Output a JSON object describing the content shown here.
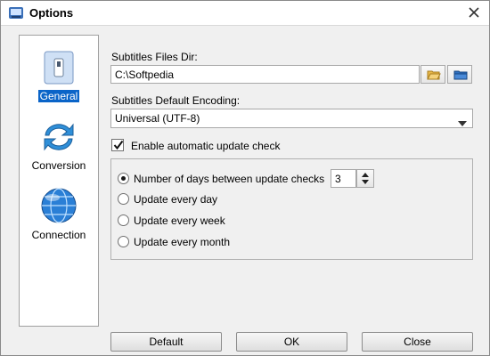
{
  "window": {
    "title": "Options",
    "icon": "options-window-icon",
    "close_icon": "close-icon"
  },
  "nav": {
    "items": [
      {
        "label": "General",
        "icon": "switch-icon",
        "active": true
      },
      {
        "label": "Conversion",
        "icon": "refresh-arrows-icon",
        "active": false
      },
      {
        "label": "Connection",
        "icon": "globe-icon",
        "active": false
      }
    ]
  },
  "general": {
    "subtitles_dir_label": "Subtitles Files Dir:",
    "subtitles_dir_value": "C:\\Softpedia",
    "encoding_label": "Subtitles Default Encoding:",
    "encoding_value": "Universal (UTF-8)",
    "auto_update_label": "Enable automatic update check",
    "auto_update_checked": true,
    "update_options": [
      {
        "label": "Number of days between update checks",
        "selected": true
      },
      {
        "label": "Update every day",
        "selected": false
      },
      {
        "label": "Update every week",
        "selected": false
      },
      {
        "label": "Update every month",
        "selected": false
      }
    ],
    "days_value": "3"
  },
  "buttons": {
    "default": "Default",
    "ok": "OK",
    "close": "Close"
  },
  "colors": {
    "accent": "#0a64c8",
    "folder": "#e8b84a",
    "folder_blue": "#2e6fc0"
  }
}
